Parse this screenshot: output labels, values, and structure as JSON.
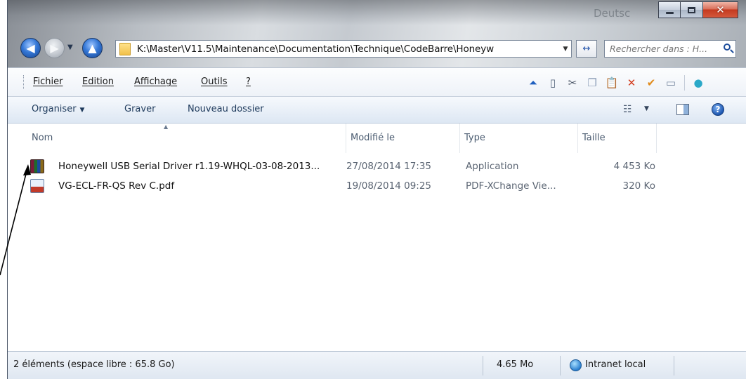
{
  "window": {
    "glass_text": "Deutsc",
    "buttons": {
      "minimize": "minimize",
      "maximize": "maximize",
      "close": "close"
    }
  },
  "nav": {
    "address": "K:\\Master\\V11.5\\Maintenance\\Documentation\\Technique\\CodeBarre\\Honeyw",
    "search_placeholder": "Rechercher dans : H...",
    "refresh_glyph": "↔"
  },
  "menu": {
    "items": [
      "Fichier",
      "Edition",
      "Affichage",
      "Outils",
      "?"
    ]
  },
  "commandbar": {
    "organize": "Organiser",
    "burn": "Graver",
    "new_folder": "Nouveau dossier"
  },
  "columns": [
    "Nom",
    "Modifié le",
    "Type",
    "Taille"
  ],
  "files": [
    {
      "name": "Honeywell USB Serial Driver r1.19-WHQL-03-08-2013...",
      "modified": "27/08/2014 17:35",
      "type": "Application",
      "size": "4 453 Ko",
      "icon": "winrar-archive-icon"
    },
    {
      "name": "VG-ECL-FR-QS Rev C.pdf",
      "modified": "19/08/2014 09:25",
      "type": "PDF-XChange Vie...",
      "size": "320 Ko",
      "icon": "pdf-file-icon"
    }
  ],
  "status": {
    "items": "2 éléments (espace libre : 65.8 Go)",
    "total_size": "4.65 Mo",
    "zone": "Intranet local"
  },
  "colors": {
    "accent_blue": "#1d56b0",
    "close_red": "#c43a1f",
    "folder_yellow": "#f1c04a"
  }
}
